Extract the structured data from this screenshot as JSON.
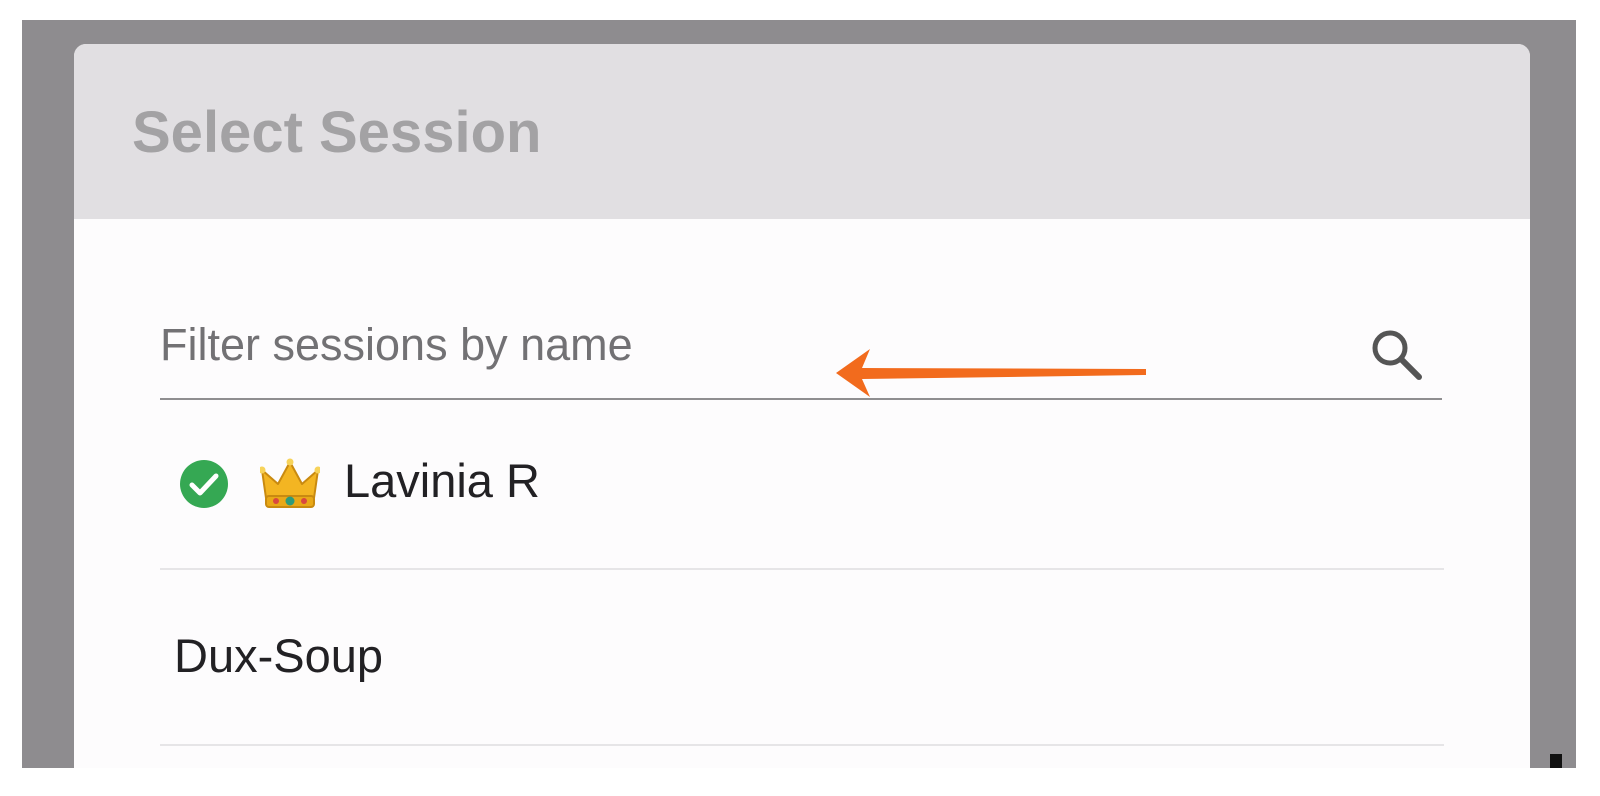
{
  "dialog": {
    "title": "Select Session"
  },
  "filter": {
    "placeholder": "Filter sessions by name",
    "value": "",
    "icon": "search-icon"
  },
  "annotation": {
    "arrow_color": "#f26b1d"
  },
  "sessions": [
    {
      "label": "Lavinia R",
      "active": true,
      "icons": [
        "check-circle-icon",
        "crown-icon"
      ]
    },
    {
      "label": "Dux-Soup",
      "active": false,
      "icons": []
    }
  ],
  "colors": {
    "header_bg": "#e1dfe2",
    "title_text": "#a3a2a4",
    "active_green": "#35a853",
    "backdrop": "#8e8c8f"
  }
}
